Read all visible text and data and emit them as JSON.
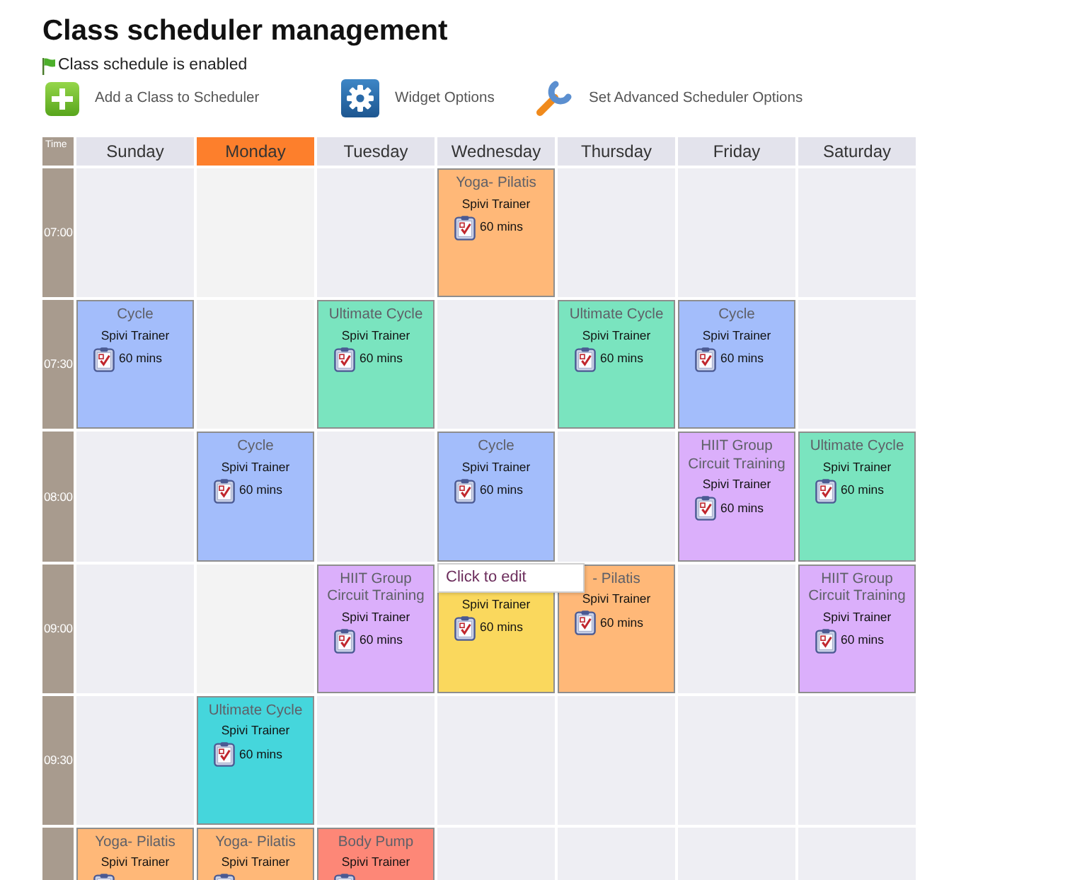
{
  "title": "Class scheduler management",
  "status": {
    "text": "Class schedule is enabled"
  },
  "actions": [
    {
      "label": "Add a Class to Scheduler",
      "kind": "add"
    },
    {
      "label": "Widget Options",
      "kind": "settings"
    },
    {
      "label": "Set Advanced Scheduler Options",
      "kind": "wrench"
    }
  ],
  "schedule": {
    "time_heading": "Time",
    "days": [
      {
        "label": "Sunday",
        "selected": false
      },
      {
        "label": "Monday",
        "selected": true
      },
      {
        "label": "Tuesday",
        "selected": false
      },
      {
        "label": "Wednesday",
        "selected": false
      },
      {
        "label": "Thursday",
        "selected": false
      },
      {
        "label": "Friday",
        "selected": false
      },
      {
        "label": "Saturday",
        "selected": false
      }
    ],
    "rows": [
      {
        "time": "07:00",
        "cells": [
          null,
          null,
          null,
          {
            "title": "Yoga- Pilatis",
            "trainer": "Spivi Trainer",
            "duration": "60 mins",
            "color": "#ffb878"
          },
          null,
          null,
          null
        ]
      },
      {
        "time": "07:30",
        "cells": [
          {
            "title": "Cycle",
            "trainer": "Spivi Trainer",
            "duration": "60 mins",
            "color": "#a3bdfb"
          },
          null,
          {
            "title": "Ultimate Cycle",
            "trainer": "Spivi Trainer",
            "duration": "60 mins",
            "color": "#7ae4bf"
          },
          null,
          {
            "title": "Ultimate Cycle",
            "trainer": "Spivi Trainer",
            "duration": "60 mins",
            "color": "#7ae4bf"
          },
          {
            "title": "Cycle",
            "trainer": "Spivi Trainer",
            "duration": "60 mins",
            "color": "#a3bdfb"
          },
          null
        ]
      },
      {
        "time": "08:00",
        "cells": [
          null,
          {
            "title": "Cycle",
            "trainer": "Spivi Trainer",
            "duration": "60 mins",
            "color": "#a3bdfb"
          },
          null,
          {
            "title": "Cycle",
            "trainer": "Spivi Trainer",
            "duration": "60 mins",
            "color": "#a3bdfb"
          },
          null,
          {
            "title": "HIIT Group Circuit Training",
            "trainer": "Spivi Trainer",
            "duration": "60 mins",
            "color": "#dbaffb"
          },
          {
            "title": "Ultimate Cycle",
            "trainer": "Spivi Trainer",
            "duration": "60 mins",
            "color": "#7ae4bf"
          }
        ]
      },
      {
        "time": "09:00",
        "cells": [
          null,
          null,
          {
            "title": "HIIT Group Circuit Training",
            "trainer": "Spivi Trainer",
            "duration": "60 mins",
            "color": "#dbaffb"
          },
          {
            "trainer": "Spivi Trainer",
            "duration": "60 mins",
            "color": "#fad85d",
            "tooltip": "Click to edit"
          },
          {
            "title": "- Pilatis",
            "trainer": "Spivi Trainer",
            "duration": "60 mins",
            "color": "#ffb878"
          },
          null,
          {
            "title": "HIIT Group Circuit Training",
            "trainer": "Spivi Trainer",
            "duration": "60 mins",
            "color": "#dbaffb"
          }
        ]
      },
      {
        "time": "09:30",
        "cells": [
          null,
          {
            "title": "Ultimate Cycle",
            "trainer": "Spivi Trainer",
            "duration": "60 mins",
            "color": "#45d6dc"
          },
          null,
          null,
          null,
          null,
          null
        ]
      },
      {
        "cells": [
          {
            "title": "Yoga- Pilatis",
            "trainer": "Spivi Trainer",
            "color": "#ffb878"
          },
          {
            "title": "Yoga- Pilatis",
            "trainer": "Spivi Trainer",
            "color": "#ffb878"
          },
          {
            "title": "Body Pump",
            "trainer": "Spivi Trainer",
            "color": "#fd8777"
          },
          null,
          null,
          null,
          null
        ]
      }
    ]
  }
}
